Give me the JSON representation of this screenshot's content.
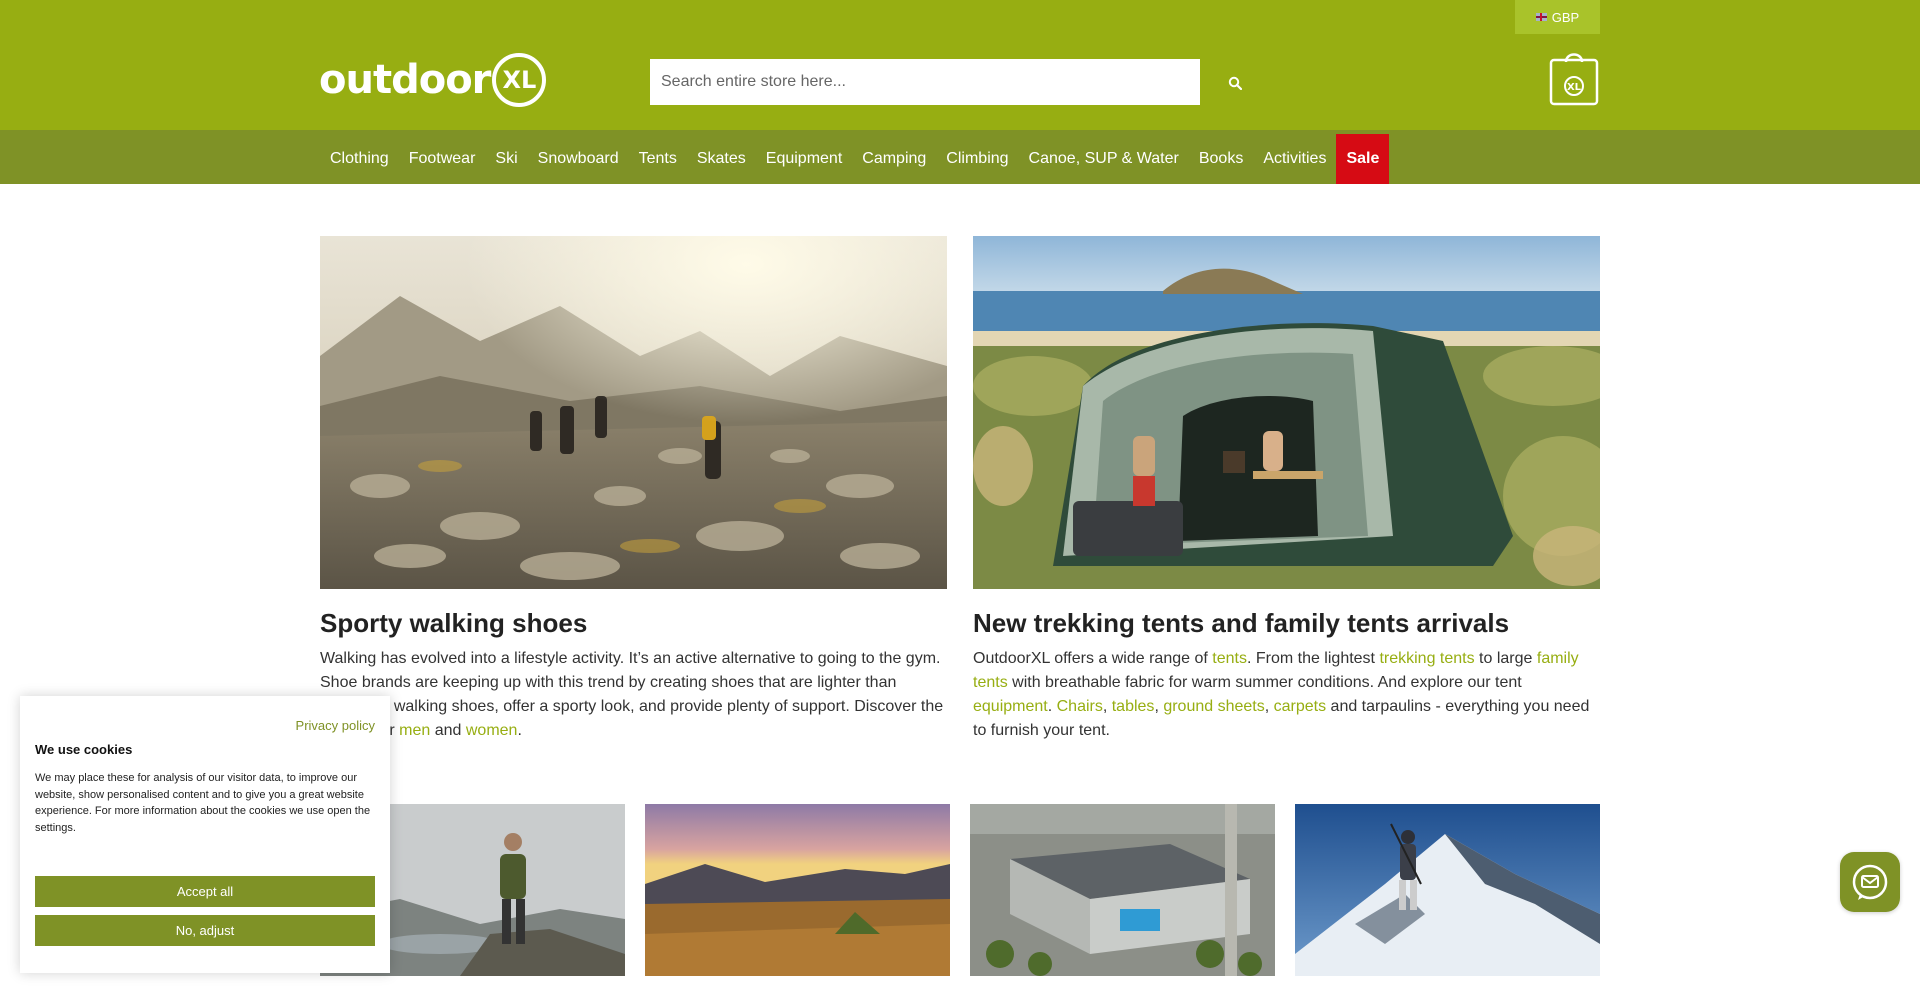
{
  "header": {
    "currency": "GBP",
    "logo_text": "outdoor",
    "logo_badge": "XL",
    "search_placeholder": "Search entire store here...",
    "cart_badge": "XL"
  },
  "nav": {
    "items": [
      "Clothing",
      "Footwear",
      "Ski",
      "Snowboard",
      "Tents",
      "Skates",
      "Equipment",
      "Camping",
      "Climbing",
      "Canoe, SUP & Water",
      "Books",
      "Activities"
    ],
    "sale": "Sale"
  },
  "cards": {
    "walking": {
      "title": "Sporty walking shoes",
      "text_1": "Walking has evolved into a lifestyle activity. It’s an active alternative to going to the gym. Shoe brands are keeping up with this trend by creating shoes that are lighter than traditional walking shoes, offer a sporty look, and provide plenty of support. Discover the options for ",
      "link_men": "men",
      "text_2": " and ",
      "link_women": "women",
      "text_3": "."
    },
    "tents": {
      "title": "New trekking tents and family tents arrivals",
      "t1": "OutdoorXL offers a wide range of ",
      "l_tents": "tents",
      "t2": ". From the lightest ",
      "l_trekking": "trekking tents",
      "t3": " to large ",
      "l_family": "family tents",
      "t4": " with breathable fabric for warm summer conditions. And explore our tent ",
      "l_equipment": "equipment",
      "t5": ". ",
      "l_chairs": "Chairs",
      "t6": ", ",
      "l_tables": "tables",
      "t7": ", ",
      "l_ground": "ground sheets",
      "t8": ", ",
      "l_carpets": "carpets",
      "t9": " and tarpaulins - everything you need to furnish your tent."
    }
  },
  "cookie": {
    "privacy_link": "Privacy policy",
    "title": "We use cookies",
    "text": "We may place these for analysis of our visitor data, to improve our website, show personalised content and to give you a great website experience. For more information about the cookies we use open the settings.",
    "accept_label": "Accept all",
    "adjust_label": "No, adjust"
  },
  "colors": {
    "brand_green": "#97ae12",
    "nav_green": "#7f9226",
    "sale_red": "#d60b14"
  },
  "icons": [
    "flag-uk-icon",
    "search-icon",
    "shopping-bag-icon",
    "chat-icon"
  ]
}
